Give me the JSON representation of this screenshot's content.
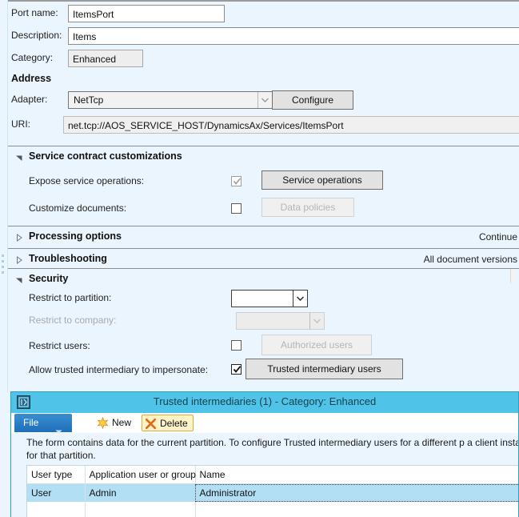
{
  "form": {
    "port_name": {
      "label": "Port name:",
      "value": "ItemsPort"
    },
    "description": {
      "label": "Description:",
      "value": "Items"
    },
    "category": {
      "label": "Category:",
      "value": "Enhanced"
    },
    "address_header": "Address",
    "adapter": {
      "label": "Adapter:",
      "value": "NetTcp"
    },
    "configure_button": "Configure",
    "uri": {
      "label": "URI:",
      "value": "net.tcp://AOS_SERVICE_HOST/DynamicsAx/Services/ItemsPort"
    }
  },
  "groups": {
    "service_contract": {
      "title": "Service contract customizations",
      "expanded": true,
      "expose_service_operations": {
        "label": "Expose service operations:",
        "checked": true
      },
      "service_operations_button": "Service operations",
      "customize_documents": {
        "label": "Customize documents:",
        "checked": false
      },
      "data_policies_button": "Data policies"
    },
    "processing_options": {
      "title": "Processing options",
      "expanded": false,
      "summary": "Continue"
    },
    "troubleshooting": {
      "title": "Troubleshooting",
      "expanded": false,
      "summary": "All document versions"
    },
    "security": {
      "title": "Security",
      "expanded": true,
      "restrict_partition": {
        "label": "Restrict to partition:",
        "value": ""
      },
      "restrict_company": {
        "label": "Restrict to company:",
        "value": ""
      },
      "restrict_users": {
        "label": "Restrict users:",
        "checked": false
      },
      "authorized_users_button": "Authorized users",
      "allow_trusted": {
        "label": "Allow trusted intermediary to impersonate:",
        "checked": true
      },
      "trusted_intermediary_users_button": "Trusted intermediary users"
    }
  },
  "dialog": {
    "title": "Trusted intermediaries (1) - Category: Enhanced",
    "icon": "form-window-icon",
    "toolbar": {
      "file_label": "File",
      "new_label": "New",
      "delete_label": "Delete"
    },
    "note": "The form contains data for the current partition. To configure Trusted intermediary users for a different p a client instance for that partition.",
    "grid": {
      "columns": [
        "User type",
        "Application user or group",
        "Name"
      ],
      "rows": [
        [
          "User",
          "Admin",
          "Administrator"
        ]
      ]
    }
  },
  "colors": {
    "background": "#eaf5fd",
    "dialog_titlebar": "#50c3e8",
    "file_tab": "#1d6fba",
    "selected_row": "#b3dff5",
    "hot_button": "#fdf3c8"
  }
}
